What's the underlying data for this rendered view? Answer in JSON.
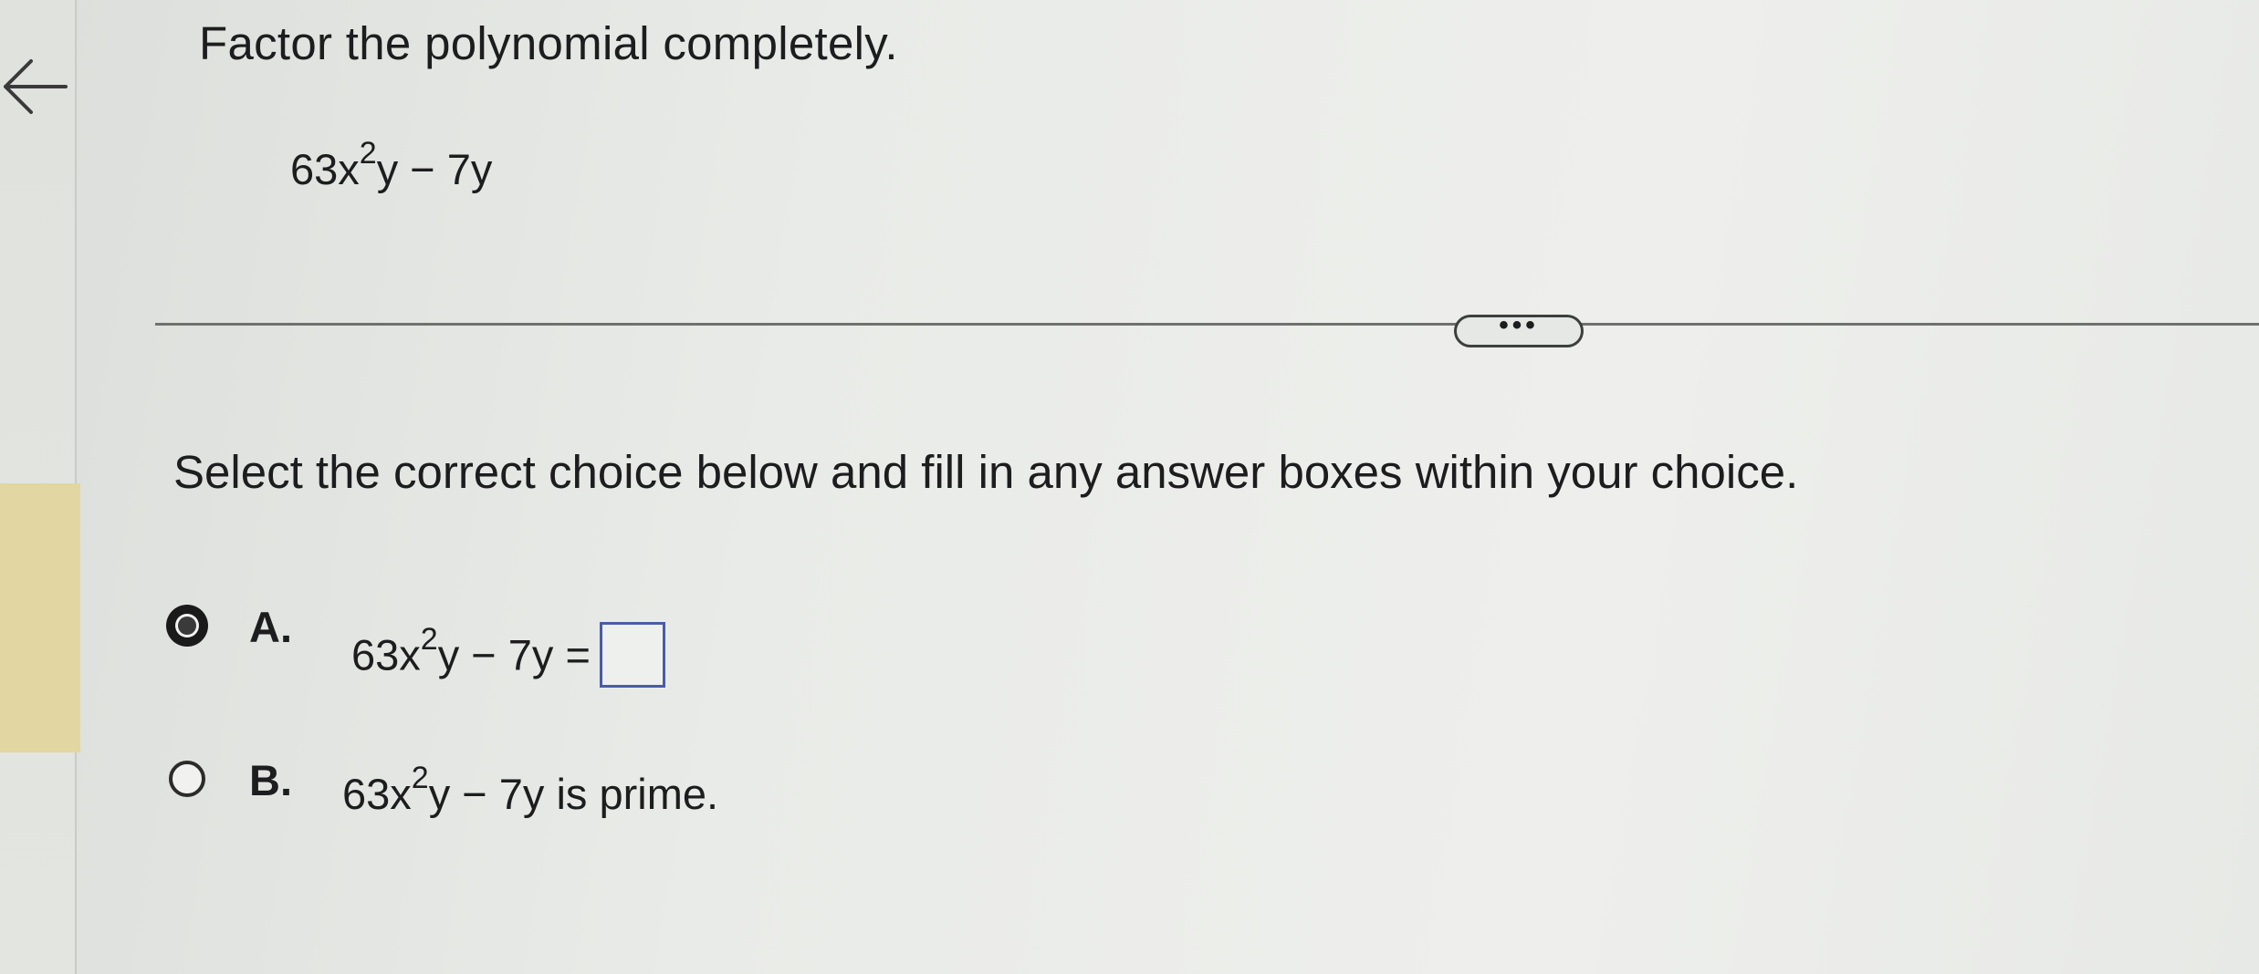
{
  "icons": {
    "back": "left-arrow-icon",
    "more": "ellipsis-icon"
  },
  "question": {
    "title": "Factor the polynomial completely.",
    "expression_part1": "63x",
    "expression_exponent": "2",
    "expression_part2": "y − 7y"
  },
  "more_button": {
    "label": "•••"
  },
  "instruction": "Select the correct choice below and fill in any answer boxes within your choice.",
  "choices": [
    {
      "letter": "A.",
      "expr_part1": "63x",
      "expr_exponent": "2",
      "expr_part2": "y − 7y =",
      "selected": true,
      "answer_value": ""
    },
    {
      "letter": "B.",
      "expr_part1": "63x",
      "expr_exponent": "2",
      "expr_part2": "y − 7y is prime.",
      "selected": false
    }
  ],
  "colors": {
    "background": "#e6e8e5",
    "accent_tab": "#e2d7a2",
    "answer_box_border": "#4a5ba8",
    "text": "#1d1d1f"
  }
}
